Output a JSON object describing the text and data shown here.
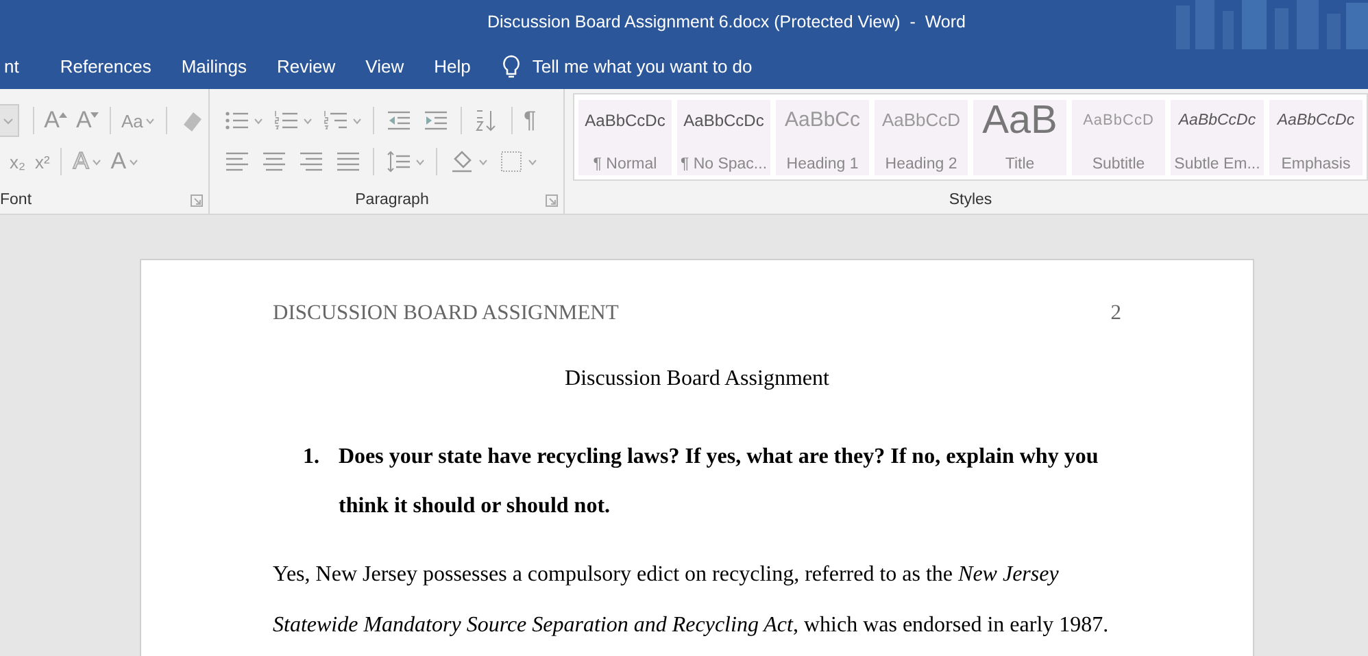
{
  "window": {
    "title": "Discussion Board Assignment 6.docx (Protected View)  -  Word"
  },
  "tabs": [
    {
      "label": "nt",
      "selected": false
    },
    {
      "label": "References",
      "selected": false
    },
    {
      "label": "Mailings",
      "selected": false
    },
    {
      "label": "Review",
      "selected": false
    },
    {
      "label": "View",
      "selected": false
    },
    {
      "label": "Help",
      "selected": false
    }
  ],
  "tell_me": "Tell me what you want to do",
  "ribbon": {
    "groups": [
      {
        "label": "Font",
        "glyphs": [
          "A",
          "A",
          "Aa",
          "x₂",
          "x²",
          "A",
          "A"
        ]
      },
      {
        "label": "Paragraph",
        "glyphs": [
          "¶"
        ]
      }
    ],
    "styles": {
      "label": "Styles",
      "items": [
        {
          "sample": "AaBbCcDc",
          "name": "¶ Normal",
          "kind": "normal"
        },
        {
          "sample": "AaBbCcDc",
          "name": "¶ No Spac...",
          "kind": "normal"
        },
        {
          "sample": "AaBbCc",
          "name": "Heading 1",
          "kind": "heading1"
        },
        {
          "sample": "AaBbCcD",
          "name": "Heading 2",
          "kind": "heading2"
        },
        {
          "sample": "AaB",
          "name": "Title",
          "kind": "title"
        },
        {
          "sample": "AaBbCcD",
          "name": "Subtitle",
          "kind": "subtitle"
        },
        {
          "sample": "AaBbCcDc",
          "name": "Subtle Em...",
          "kind": "emphasis"
        },
        {
          "sample": "AaBbCcDc",
          "name": "Emphasis",
          "kind": "emphasis"
        }
      ]
    }
  },
  "document": {
    "header": "DISCUSSION BOARD ASSIGNMENT",
    "page_number": "2",
    "title": "Discussion Board Assignment",
    "questions": [
      {
        "number": "1.",
        "text": "Does your state have recycling laws? If yes, what are they? If no, explain why you think it should or should not."
      }
    ],
    "paragraph": "Yes, New Jersey possesses a compulsory edict on recycling, referred to as the *New Jersey Statewide Mandatory Source Separation and Recycling Act*, which was endorsed in early 1987."
  }
}
